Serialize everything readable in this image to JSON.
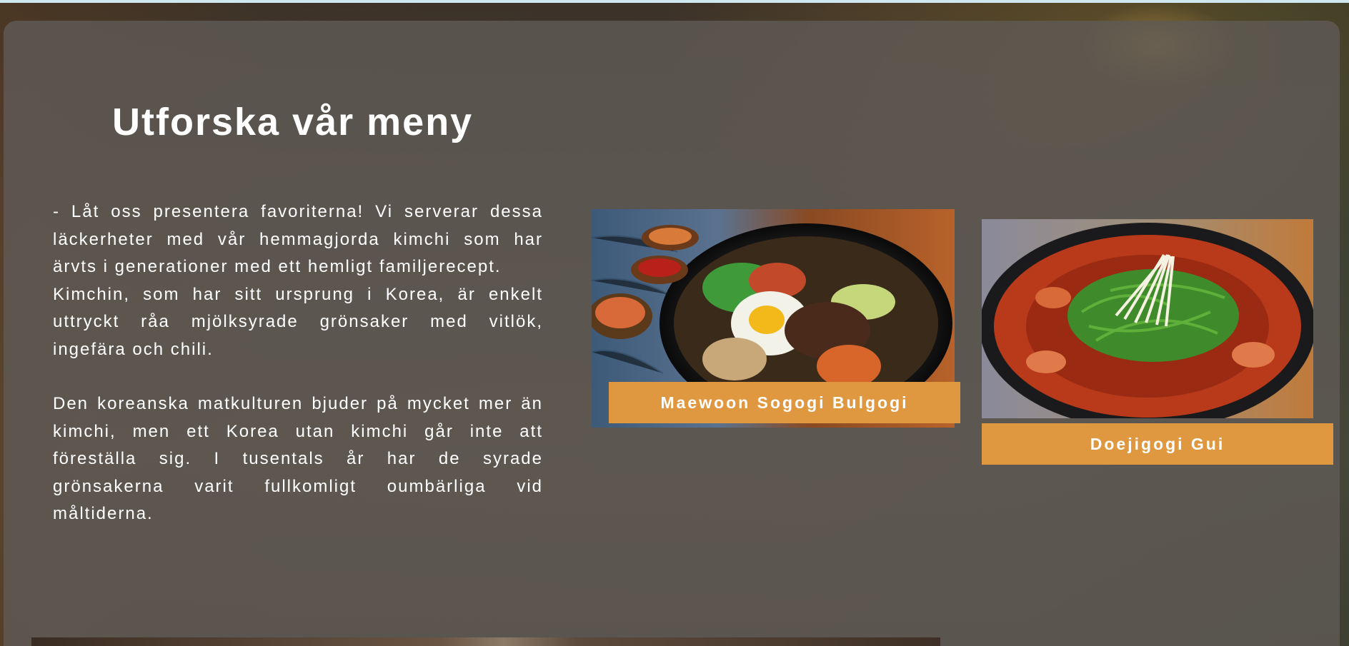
{
  "page": {
    "title": "Utforska vår meny",
    "intro_lines": [
      "- Låt oss presentera favoriterna! Vi serverar dessa läckerheter med vår hemmagjorda kimchi som har ärvts i generationer med ett hemligt familjerecept.",
      "Kimchin, som har sitt ursprung i Korea, är enkelt uttryckt råa mjölksyrade grönsaker med vitlök, ingefära och chili.",
      "Den koreanska matkulturen bjuder på mycket mer än kimchi, men ett Korea utan kimchi går inte att föreställa sig. I tusentals år har de syrade grönsakerna varit fullkomligt oumbärliga vid måltiderna."
    ]
  },
  "dishes": [
    {
      "name": "Maewoon Sogogi Bulgogi",
      "image_alt": "bulgogi-bibimbap-bowl"
    },
    {
      "name": "Doejigogi Gui",
      "image_alt": "spicy-stew-pot"
    }
  ],
  "colors": {
    "accent": "#e09840",
    "panel": "#5f5a56",
    "text": "#ffffff"
  }
}
